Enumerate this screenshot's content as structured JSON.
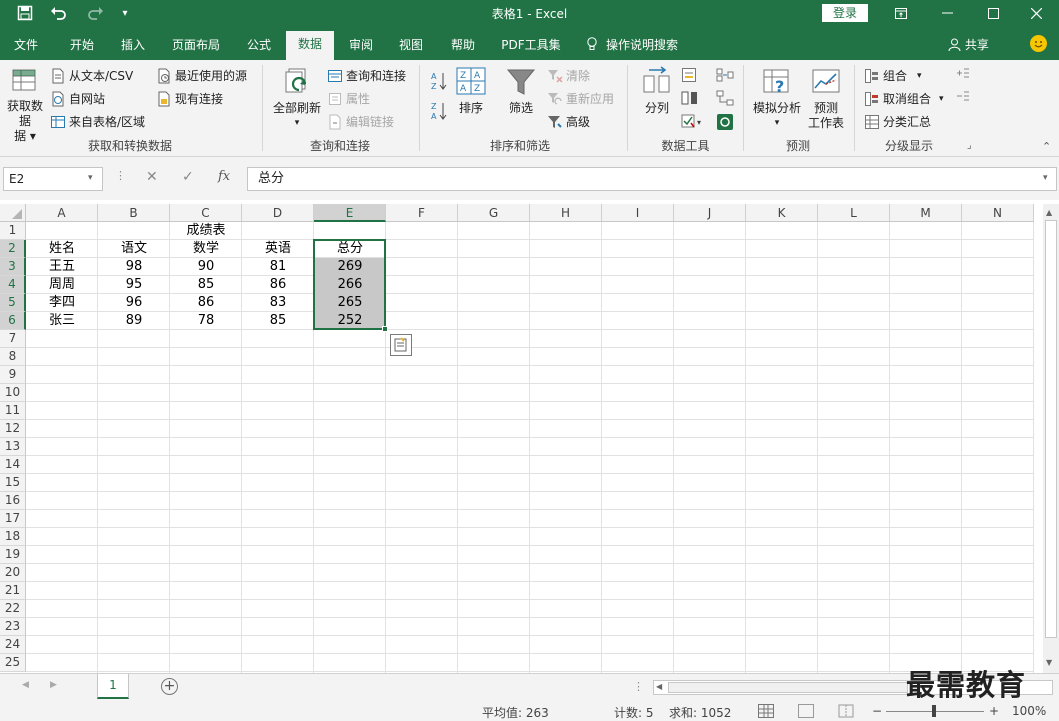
{
  "title_bar": {
    "doc_title": "表格1  -  Excel",
    "login_label": "登录",
    "quick_access": [
      "save-icon",
      "undo-icon",
      "redo-icon",
      "customize-icon"
    ],
    "window_buttons": [
      "ribbon-display-icon",
      "minimize-icon",
      "maximize-icon",
      "close-icon"
    ]
  },
  "tabs": [
    {
      "label": "文件"
    },
    {
      "label": "开始"
    },
    {
      "label": "插入"
    },
    {
      "label": "页面布局"
    },
    {
      "label": "公式"
    },
    {
      "label": "数据",
      "active": true
    },
    {
      "label": "审阅"
    },
    {
      "label": "视图"
    },
    {
      "label": "帮助"
    },
    {
      "label": "PDF工具集"
    },
    {
      "label": "操作说明搜索"
    }
  ],
  "share_label": "共享",
  "ribbon": {
    "get_transform": {
      "label": "获取和转换数据",
      "big_button": "获取数据",
      "big_button_line2": "据",
      "from_text": "从文本/CSV",
      "from_web": "自网站",
      "from_table": "来自表格/区域",
      "recent_sources": "最近使用的源",
      "existing_conn": "现有连接"
    },
    "queries": {
      "label": "查询和连接",
      "refresh_all": "全部刷新",
      "queries_conn": "查询和连接",
      "properties": "属性",
      "edit_links": "编辑链接"
    },
    "sort_filter": {
      "label": "排序和筛选",
      "sort": "排序",
      "filter": "筛选",
      "clear": "清除",
      "reapply": "重新应用",
      "advanced": "高级"
    },
    "data_tools": {
      "label": "数据工具",
      "split": "分列"
    },
    "forecast": {
      "label": "预测",
      "what_if": "模拟分析",
      "forecast_sheet_1": "预测",
      "forecast_sheet_2": "工作表"
    },
    "outline": {
      "label": "分级显示",
      "group": "组合",
      "ungroup": "取消组合",
      "subtotal": "分类汇总"
    }
  },
  "formula_bar": {
    "name_box": "E2",
    "fx": "fx",
    "content": "总分"
  },
  "columns": [
    "A",
    "B",
    "C",
    "D",
    "E",
    "F",
    "G",
    "H",
    "I",
    "J",
    "K",
    "L",
    "M",
    "N"
  ],
  "rows": [
    "1",
    "2",
    "3",
    "4",
    "5",
    "6",
    "7",
    "8",
    "9",
    "10",
    "11",
    "12",
    "13",
    "14",
    "15",
    "16",
    "17",
    "18",
    "19",
    "20",
    "21",
    "22",
    "23",
    "24",
    "25"
  ],
  "sheet": {
    "title": "成绩表",
    "headers": [
      "姓名",
      "语文",
      "数学",
      "英语",
      "总分"
    ],
    "data": [
      [
        "王五",
        "98",
        "90",
        "81",
        "269"
      ],
      [
        "周周",
        "95",
        "85",
        "86",
        "266"
      ],
      [
        "李四",
        "96",
        "86",
        "83",
        "265"
      ],
      [
        "张三",
        "89",
        "78",
        "85",
        "252"
      ]
    ]
  },
  "sheet_tab": "1",
  "status": {
    "average": "平均值: 263",
    "count": "计数: 5",
    "sum": "求和: 1052",
    "zoom": "100%"
  },
  "watermark": "最需教育"
}
